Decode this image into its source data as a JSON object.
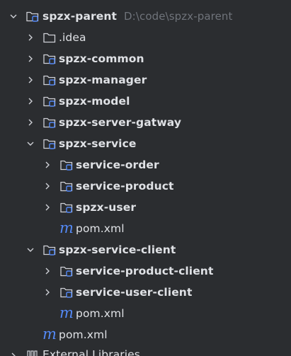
{
  "tree": {
    "root": {
      "name": "spzx-parent",
      "path": "D:\\code\\spzx-parent"
    },
    "idea": {
      "name": ".idea"
    },
    "spzx_common": {
      "name": "spzx-common"
    },
    "spzx_manager": {
      "name": "spzx-manager"
    },
    "spzx_model": {
      "name": "spzx-model"
    },
    "spzx_server_gatway": {
      "name": "spzx-server-gatway"
    },
    "spzx_service": {
      "name": "spzx-service",
      "children": {
        "service_order": {
          "name": "service-order"
        },
        "service_product": {
          "name": "service-product"
        },
        "spzx_user": {
          "name": "spzx-user"
        },
        "pom": {
          "name": "pom.xml"
        }
      }
    },
    "spzx_service_client": {
      "name": "spzx-service-client",
      "children": {
        "service_product_client": {
          "name": "service-product-client"
        },
        "service_user_client": {
          "name": "service-user-client"
        },
        "pom": {
          "name": "pom.xml"
        }
      }
    },
    "root_pom": {
      "name": "pom.xml"
    },
    "external_libraries": {
      "name": "External Libraries"
    }
  },
  "icons": {
    "expanded": "chevron-down-icon",
    "collapsed": "chevron-right-icon",
    "module": "module-folder-icon",
    "folder": "folder-icon",
    "maven": "maven-pom-icon",
    "library": "library-icon"
  },
  "colors": {
    "background": "#2b2d30",
    "text": "#dfe1e5",
    "path": "#6f737a",
    "chevron": "#ced0d6",
    "folder_outline": "#ced0d6",
    "module_badge": "#548af7",
    "maven_m": "#548af7"
  }
}
